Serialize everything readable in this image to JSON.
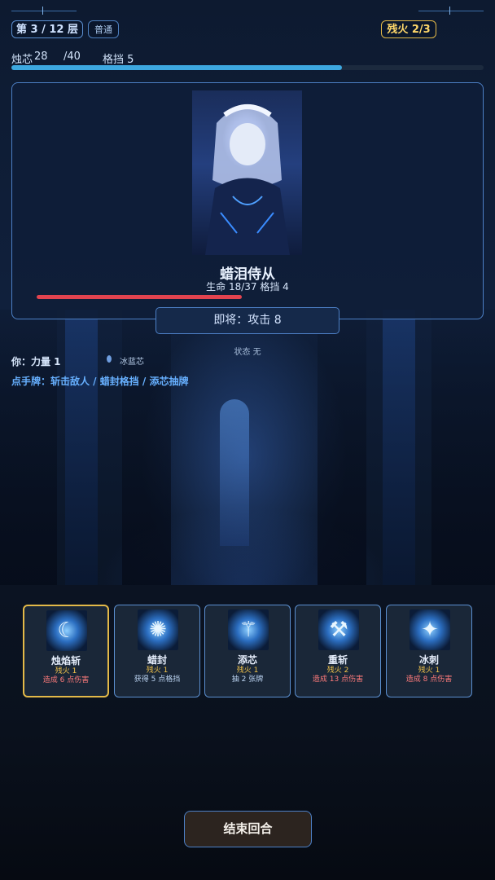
{
  "header": {
    "floor_label": "第 3 / 12 层",
    "difficulty": "普通",
    "embers": "残火 2/3"
  },
  "player_stats": {
    "core_label": "烛芯",
    "core_value": "28",
    "core_max": "/40",
    "block_text": "格挡 5",
    "core_fraction": 0.7
  },
  "enemy": {
    "name": "蜡泪侍从",
    "stats": "生命 18/37  格挡 4",
    "hp_fraction": 0.486,
    "intent": "即将：攻击 8",
    "status": "状态 无",
    "portrait": "maid-portrait"
  },
  "player": {
    "strength": "你：力量 1",
    "relic": "冰蓝芯",
    "hint": "点手牌：斩击敌人 / 蜡封格挡 / 添芯抽牌"
  },
  "hand": [
    {
      "name": "烛焰斩",
      "cost": "残火 1",
      "desc": "造成 6 点伤害",
      "icon": "slash-icon",
      "glyph": "☾",
      "desc_color": "#ff7b7b",
      "selected": true
    },
    {
      "name": "蜡封",
      "cost": "残火 1",
      "desc": "获得 5 点格挡",
      "icon": "seal-icon",
      "glyph": "✺",
      "desc_color": "#bcd4f2",
      "selected": false
    },
    {
      "name": "添芯",
      "cost": "残火 1",
      "desc": "抽 2 张牌",
      "icon": "wick-icon",
      "glyph": "⚚",
      "desc_color": "#bcd4f2",
      "selected": false
    },
    {
      "name": "重斩",
      "cost": "残火 2",
      "desc": "造成 13 点伤害",
      "icon": "heavy-slash-icon",
      "glyph": "⚒",
      "desc_color": "#ff7b7b",
      "selected": false
    },
    {
      "name": "冰刺",
      "cost": "残火 1",
      "desc": "造成 8 点伤害",
      "icon": "ice-spike-icon",
      "glyph": "✦",
      "desc_color": "#ff7b7b",
      "selected": false
    }
  ],
  "end_turn_label": "结束回合",
  "colors": {
    "accent": "#4d80c6",
    "gold": "#e3b948",
    "enemy_hp": "#e2434f",
    "core_bar": "#3da8e0",
    "damage_text": "#ff7b7b"
  }
}
